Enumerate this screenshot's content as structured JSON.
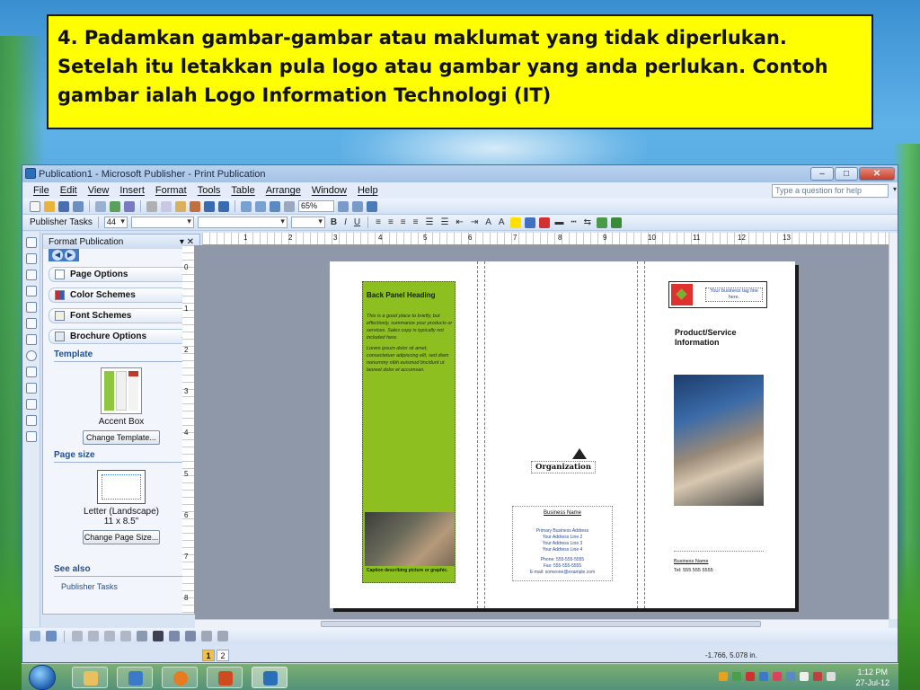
{
  "caption": {
    "text": "4. Padamkan gambar-gambar atau maklumat yang tidak diperlukan. Setelah itu letakkan pula logo atau gambar yang anda perlukan. Contoh gambar ialah Logo Information Technologi (IT)"
  },
  "window": {
    "title": "Publication1 - Microsoft Publisher - Print Publication",
    "menu": [
      "File",
      "Edit",
      "View",
      "Insert",
      "Format",
      "Tools",
      "Table",
      "Arrange",
      "Window",
      "Help"
    ],
    "question_placeholder": "Type a question for help",
    "zoom": "65%",
    "publisher_tasks": "Publisher Tasks",
    "font_size": "44"
  },
  "taskpane": {
    "title": "Format Publication",
    "items": [
      "Page Options",
      "Color Schemes",
      "Font Schemes",
      "Brochure Options"
    ],
    "template_heading": "Template",
    "template_name": "Accent Box",
    "change_template": "Change Template...",
    "pagesize_heading": "Page size",
    "pagesize_name": "Letter (Landscape)",
    "pagesize_dims": "11 x 8.5\"",
    "change_pagesize": "Change Page Size...",
    "see_also": "See also",
    "see_also_link": "Publisher Tasks"
  },
  "ruler": {
    "h_labels": [
      "1",
      "2",
      "3",
      "4",
      "5",
      "6",
      "7",
      "8",
      "9",
      "10",
      "11",
      "12",
      "13"
    ],
    "v_labels": [
      "0",
      "1",
      "2",
      "3",
      "4",
      "5",
      "6",
      "7",
      "8"
    ]
  },
  "document": {
    "back_panel_heading": "Back Panel Heading",
    "back_panel_text": "This is a good place to briefly, but effectively, summarize your products or services. Sales copy is typically not included here.",
    "back_panel_lorem": "Lorem ipsum dolor sit amet, consectetuer adipiscing elit, sed diam nonummy nibh euismod tincidunt ut laoreet dolor et accumsan.",
    "photo_caption": "Caption describing picture or graphic.",
    "organization": "Organization",
    "business_name": "Business Name",
    "business_lines": [
      "Primary Business Address",
      "Your Address Line 2",
      "Your Address Line 3",
      "Your Address Line 4",
      "Phone: 555-555-5555",
      "Fax: 555-555-5555",
      "E-mail: someone@example.com"
    ],
    "tagline": "Your business tag line here.",
    "product_title": "Product/Service Information",
    "right_business_name": "Business Name",
    "right_phone": "Tel: 555 555 5555"
  },
  "status": {
    "pages": [
      "1",
      "2"
    ],
    "coords": "-1.766, 5.078 in."
  },
  "taskbar": {
    "time": "1:12 PM",
    "date": "27-Jul-12"
  }
}
